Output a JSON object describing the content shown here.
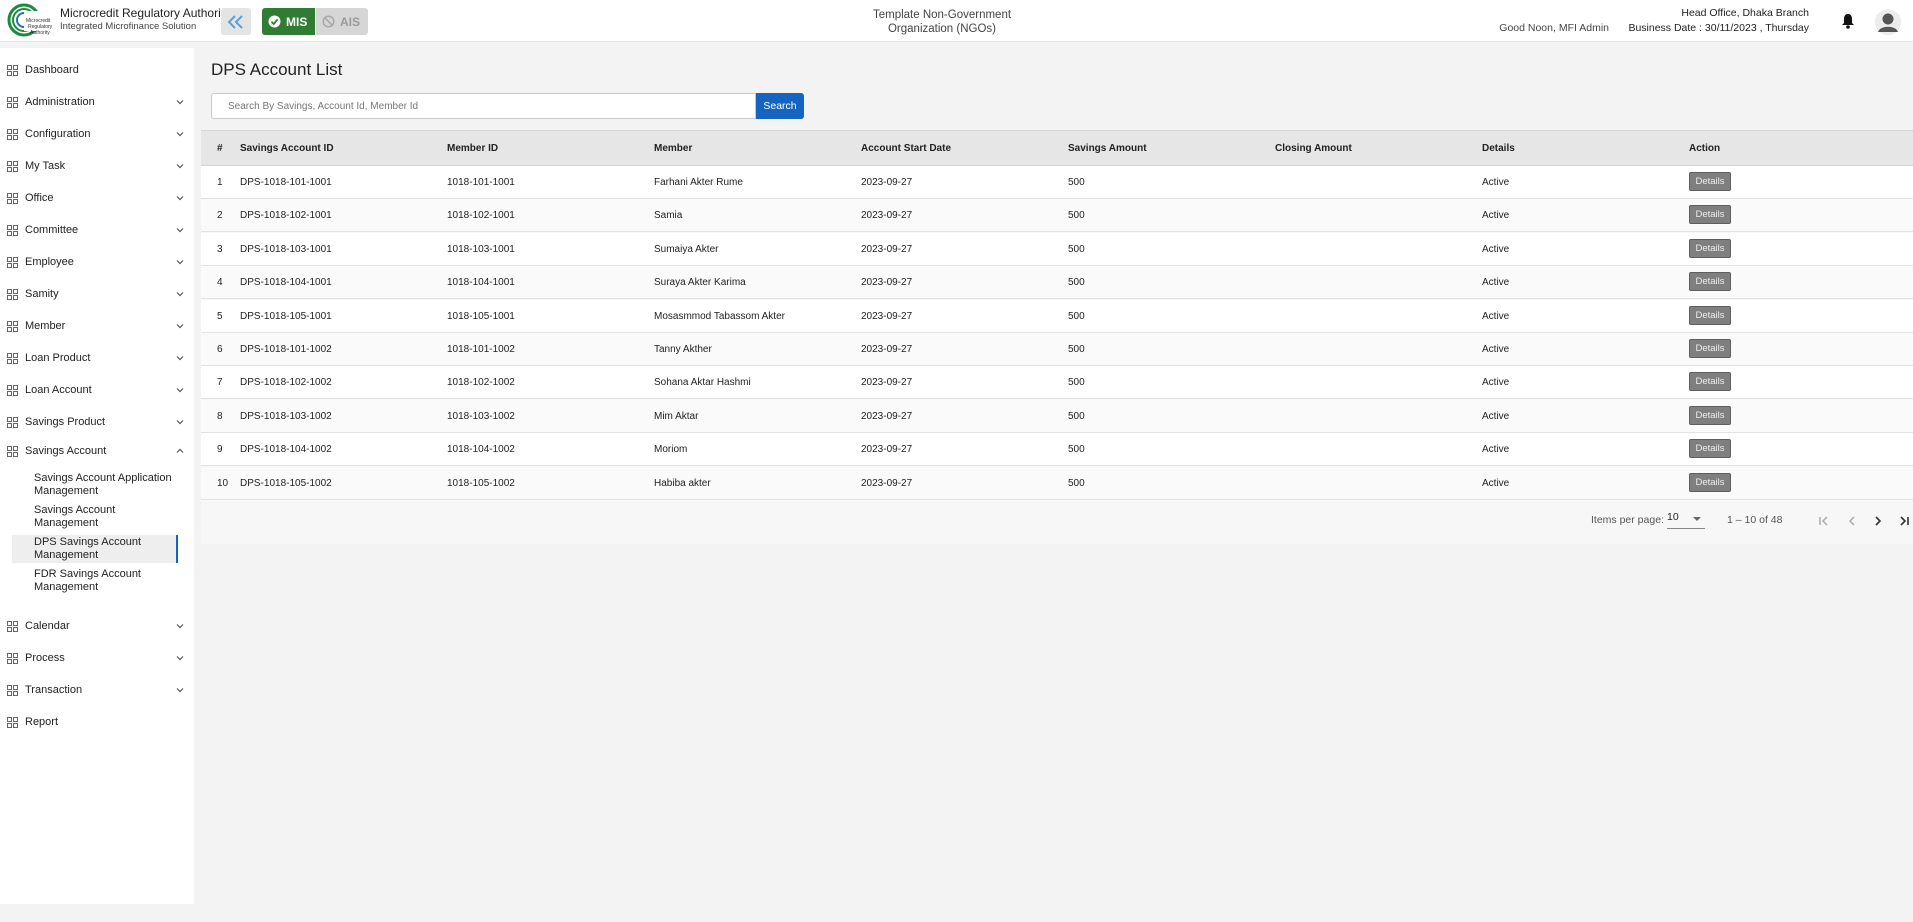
{
  "header": {
    "brand_title": "Microcredit Regulatory Authority",
    "brand_subtitle": "Integrated Microfinance Solution",
    "mis_label": "MIS",
    "ais_label": "AIS",
    "org_name": "Template Non-Government Organization (NGOs)",
    "greeting": "Good Noon, MFI Admin",
    "office": "Head Office, Dhaka Branch",
    "business_date": "Business Date : 30/11/2023 , Thursday",
    "mis_color": "#2e7d32",
    "accent_color": "#1565c0"
  },
  "sidebar": {
    "items": [
      {
        "label": "Dashboard",
        "icon": "dashboard-icon"
      },
      {
        "label": "Administration",
        "icon": "admin-icon"
      },
      {
        "label": "Configuration",
        "icon": "config-icon"
      },
      {
        "label": "My Task",
        "icon": "task-icon"
      },
      {
        "label": "Office",
        "icon": "office-icon"
      },
      {
        "label": "Committee",
        "icon": "committee-icon"
      },
      {
        "label": "Employee",
        "icon": "employee-icon"
      },
      {
        "label": "Samity",
        "icon": "samity-icon"
      },
      {
        "label": "Member",
        "icon": "member-icon"
      },
      {
        "label": "Loan Product",
        "icon": "loan-product-icon"
      },
      {
        "label": "Loan Account",
        "icon": "loan-account-icon"
      },
      {
        "label": "Savings Product",
        "icon": "savings-product-icon"
      },
      {
        "label": "Savings Account",
        "icon": "savings-account-icon"
      },
      {
        "label": "Calendar",
        "icon": "calendar-icon"
      },
      {
        "label": "Process",
        "icon": "process-icon"
      },
      {
        "label": "Transaction",
        "icon": "transaction-icon"
      },
      {
        "label": "Report",
        "icon": "report-icon"
      }
    ],
    "savings_account_sub": [
      {
        "label": "Savings Account Application Management"
      },
      {
        "label": "Savings Account Management"
      },
      {
        "label": "DPS Savings Account Management"
      },
      {
        "label": "FDR Savings Account Management"
      }
    ]
  },
  "main": {
    "title": "DPS Account List",
    "search_placeholder": "Search By Savings, Account Id, Member Id",
    "search_button": "Search",
    "columns": [
      "#",
      "Savings Account ID",
      "Member ID",
      "Member",
      "Account Start Date",
      "Savings Amount",
      "Closing Amount",
      "Details",
      "Action"
    ],
    "rows": [
      {
        "no": "1",
        "account_id": "DPS-1018-101-1001",
        "member_id": "1018-101-1001",
        "member": "Farhani Akter Rume",
        "start_date": "2023-09-27",
        "savings_amount": "500",
        "closing_amount": "",
        "details": "Active",
        "action": "Details"
      },
      {
        "no": "2",
        "account_id": "DPS-1018-102-1001",
        "member_id": "1018-102-1001",
        "member": "Samia",
        "start_date": "2023-09-27",
        "savings_amount": "500",
        "closing_amount": "",
        "details": "Active",
        "action": "Details"
      },
      {
        "no": "3",
        "account_id": "DPS-1018-103-1001",
        "member_id": "1018-103-1001",
        "member": "Sumaiya Akter",
        "start_date": "2023-09-27",
        "savings_amount": "500",
        "closing_amount": "",
        "details": "Active",
        "action": "Details"
      },
      {
        "no": "4",
        "account_id": "DPS-1018-104-1001",
        "member_id": "1018-104-1001",
        "member": "Suraya Akter Karima",
        "start_date": "2023-09-27",
        "savings_amount": "500",
        "closing_amount": "",
        "details": "Active",
        "action": "Details"
      },
      {
        "no": "5",
        "account_id": "DPS-1018-105-1001",
        "member_id": "1018-105-1001",
        "member": "Mosasmmod Tabassom Akter",
        "start_date": "2023-09-27",
        "savings_amount": "500",
        "closing_amount": "",
        "details": "Active",
        "action": "Details"
      },
      {
        "no": "6",
        "account_id": "DPS-1018-101-1002",
        "member_id": "1018-101-1002",
        "member": "Tanny Akther",
        "start_date": "2023-09-27",
        "savings_amount": "500",
        "closing_amount": "",
        "details": "Active",
        "action": "Details"
      },
      {
        "no": "7",
        "account_id": "DPS-1018-102-1002",
        "member_id": "1018-102-1002",
        "member": "Sohana Aktar Hashmi",
        "start_date": "2023-09-27",
        "savings_amount": "500",
        "closing_amount": "",
        "details": "Active",
        "action": "Details"
      },
      {
        "no": "8",
        "account_id": "DPS-1018-103-1002",
        "member_id": "1018-103-1002",
        "member": "Mim Aktar",
        "start_date": "2023-09-27",
        "savings_amount": "500",
        "closing_amount": "",
        "details": "Active",
        "action": "Details"
      },
      {
        "no": "9",
        "account_id": "DPS-1018-104-1002",
        "member_id": "1018-104-1002",
        "member": "Moriom",
        "start_date": "2023-09-27",
        "savings_amount": "500",
        "closing_amount": "",
        "details": "Active",
        "action": "Details"
      },
      {
        "no": "10",
        "account_id": "DPS-1018-105-1002",
        "member_id": "1018-105-1002",
        "member": "Habiba akter",
        "start_date": "2023-09-27",
        "savings_amount": "500",
        "closing_amount": "",
        "details": "Active",
        "action": "Details"
      }
    ]
  },
  "paginator": {
    "items_per_page_label": "Items per page:",
    "items_per_page": "10",
    "range": "1 – 10 of 48"
  }
}
